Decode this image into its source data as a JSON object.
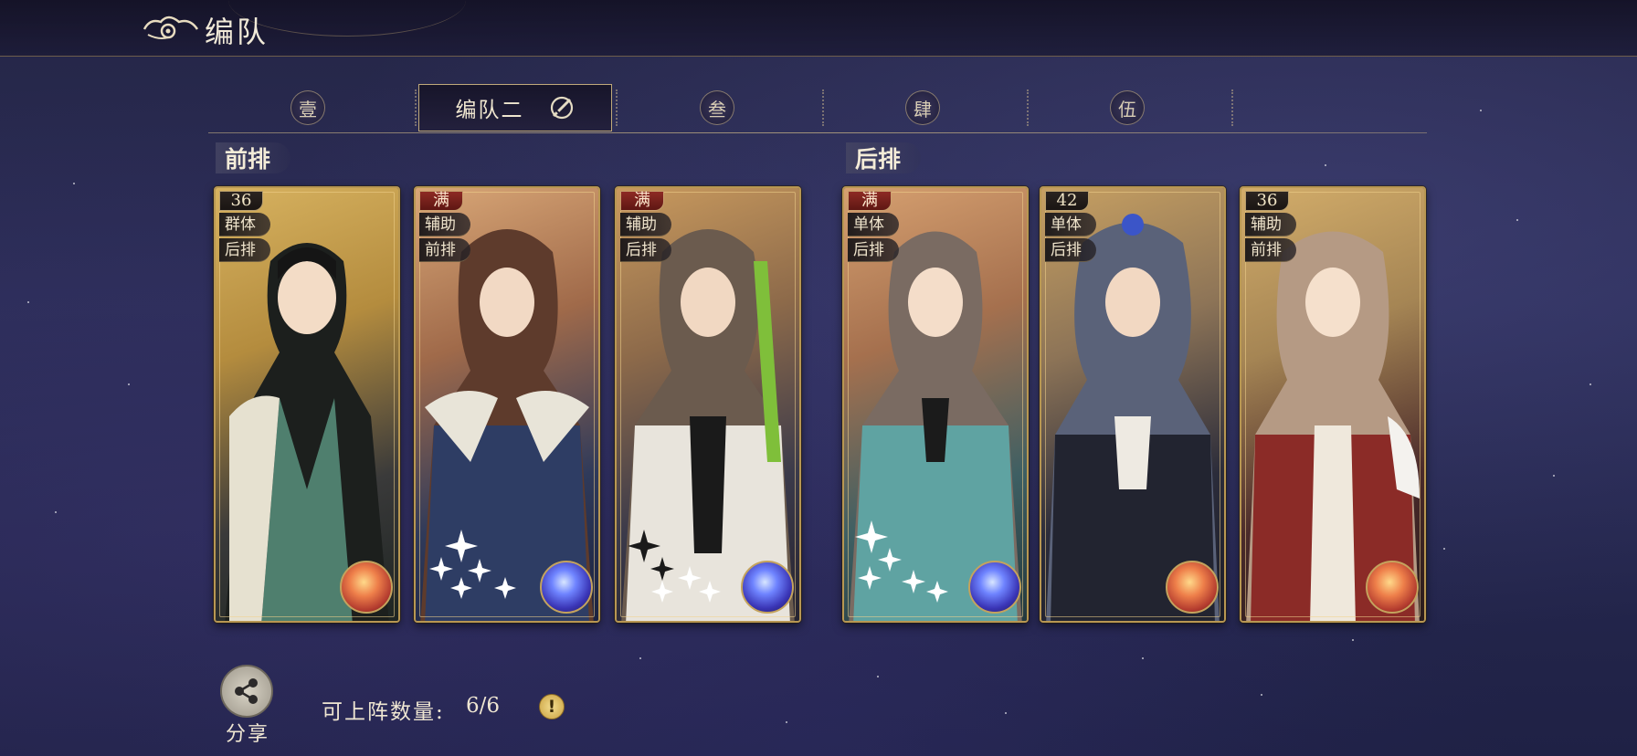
{
  "header": {
    "title": "编队",
    "back_icon": "cloud-swirl-back-icon"
  },
  "tabs": [
    {
      "label": "壹",
      "active": false
    },
    {
      "label": "编队二",
      "active": true,
      "icon": "edit-pencil-icon"
    },
    {
      "label": "叁",
      "active": false
    },
    {
      "label": "肆",
      "active": false
    },
    {
      "label": "伍",
      "active": false
    }
  ],
  "front_row": {
    "label": "前排",
    "cards": [
      {
        "level": "36",
        "tag1": "群体",
        "tag2": "后排",
        "element": "fire",
        "stars": 0
      },
      {
        "level": "满",
        "tag1": "辅助",
        "tag2": "前排",
        "element": "star",
        "stars": 6
      },
      {
        "level": "满",
        "tag1": "辅助",
        "tag2": "后排",
        "element": "star",
        "stars": 6
      }
    ]
  },
  "back_row": {
    "label": "后排",
    "cards": [
      {
        "level": "满",
        "tag1": "单体",
        "tag2": "后排",
        "element": "star",
        "stars": 6
      },
      {
        "level": "42",
        "tag1": "单体",
        "tag2": "后排",
        "element": "fire",
        "stars": 0
      },
      {
        "level": "36",
        "tag1": "辅助",
        "tag2": "前排",
        "element": "fire",
        "stars": 0
      }
    ]
  },
  "footer": {
    "share_label": "分享",
    "share_icon": "share-nodes-icon",
    "count_label": "可上阵数量:",
    "count_value": "6/6",
    "info_icon": "exclamation-info-icon"
  },
  "colors": {
    "frame_gold": "#b89752",
    "level_full_red": "#8e2a24",
    "background": "#252647"
  }
}
